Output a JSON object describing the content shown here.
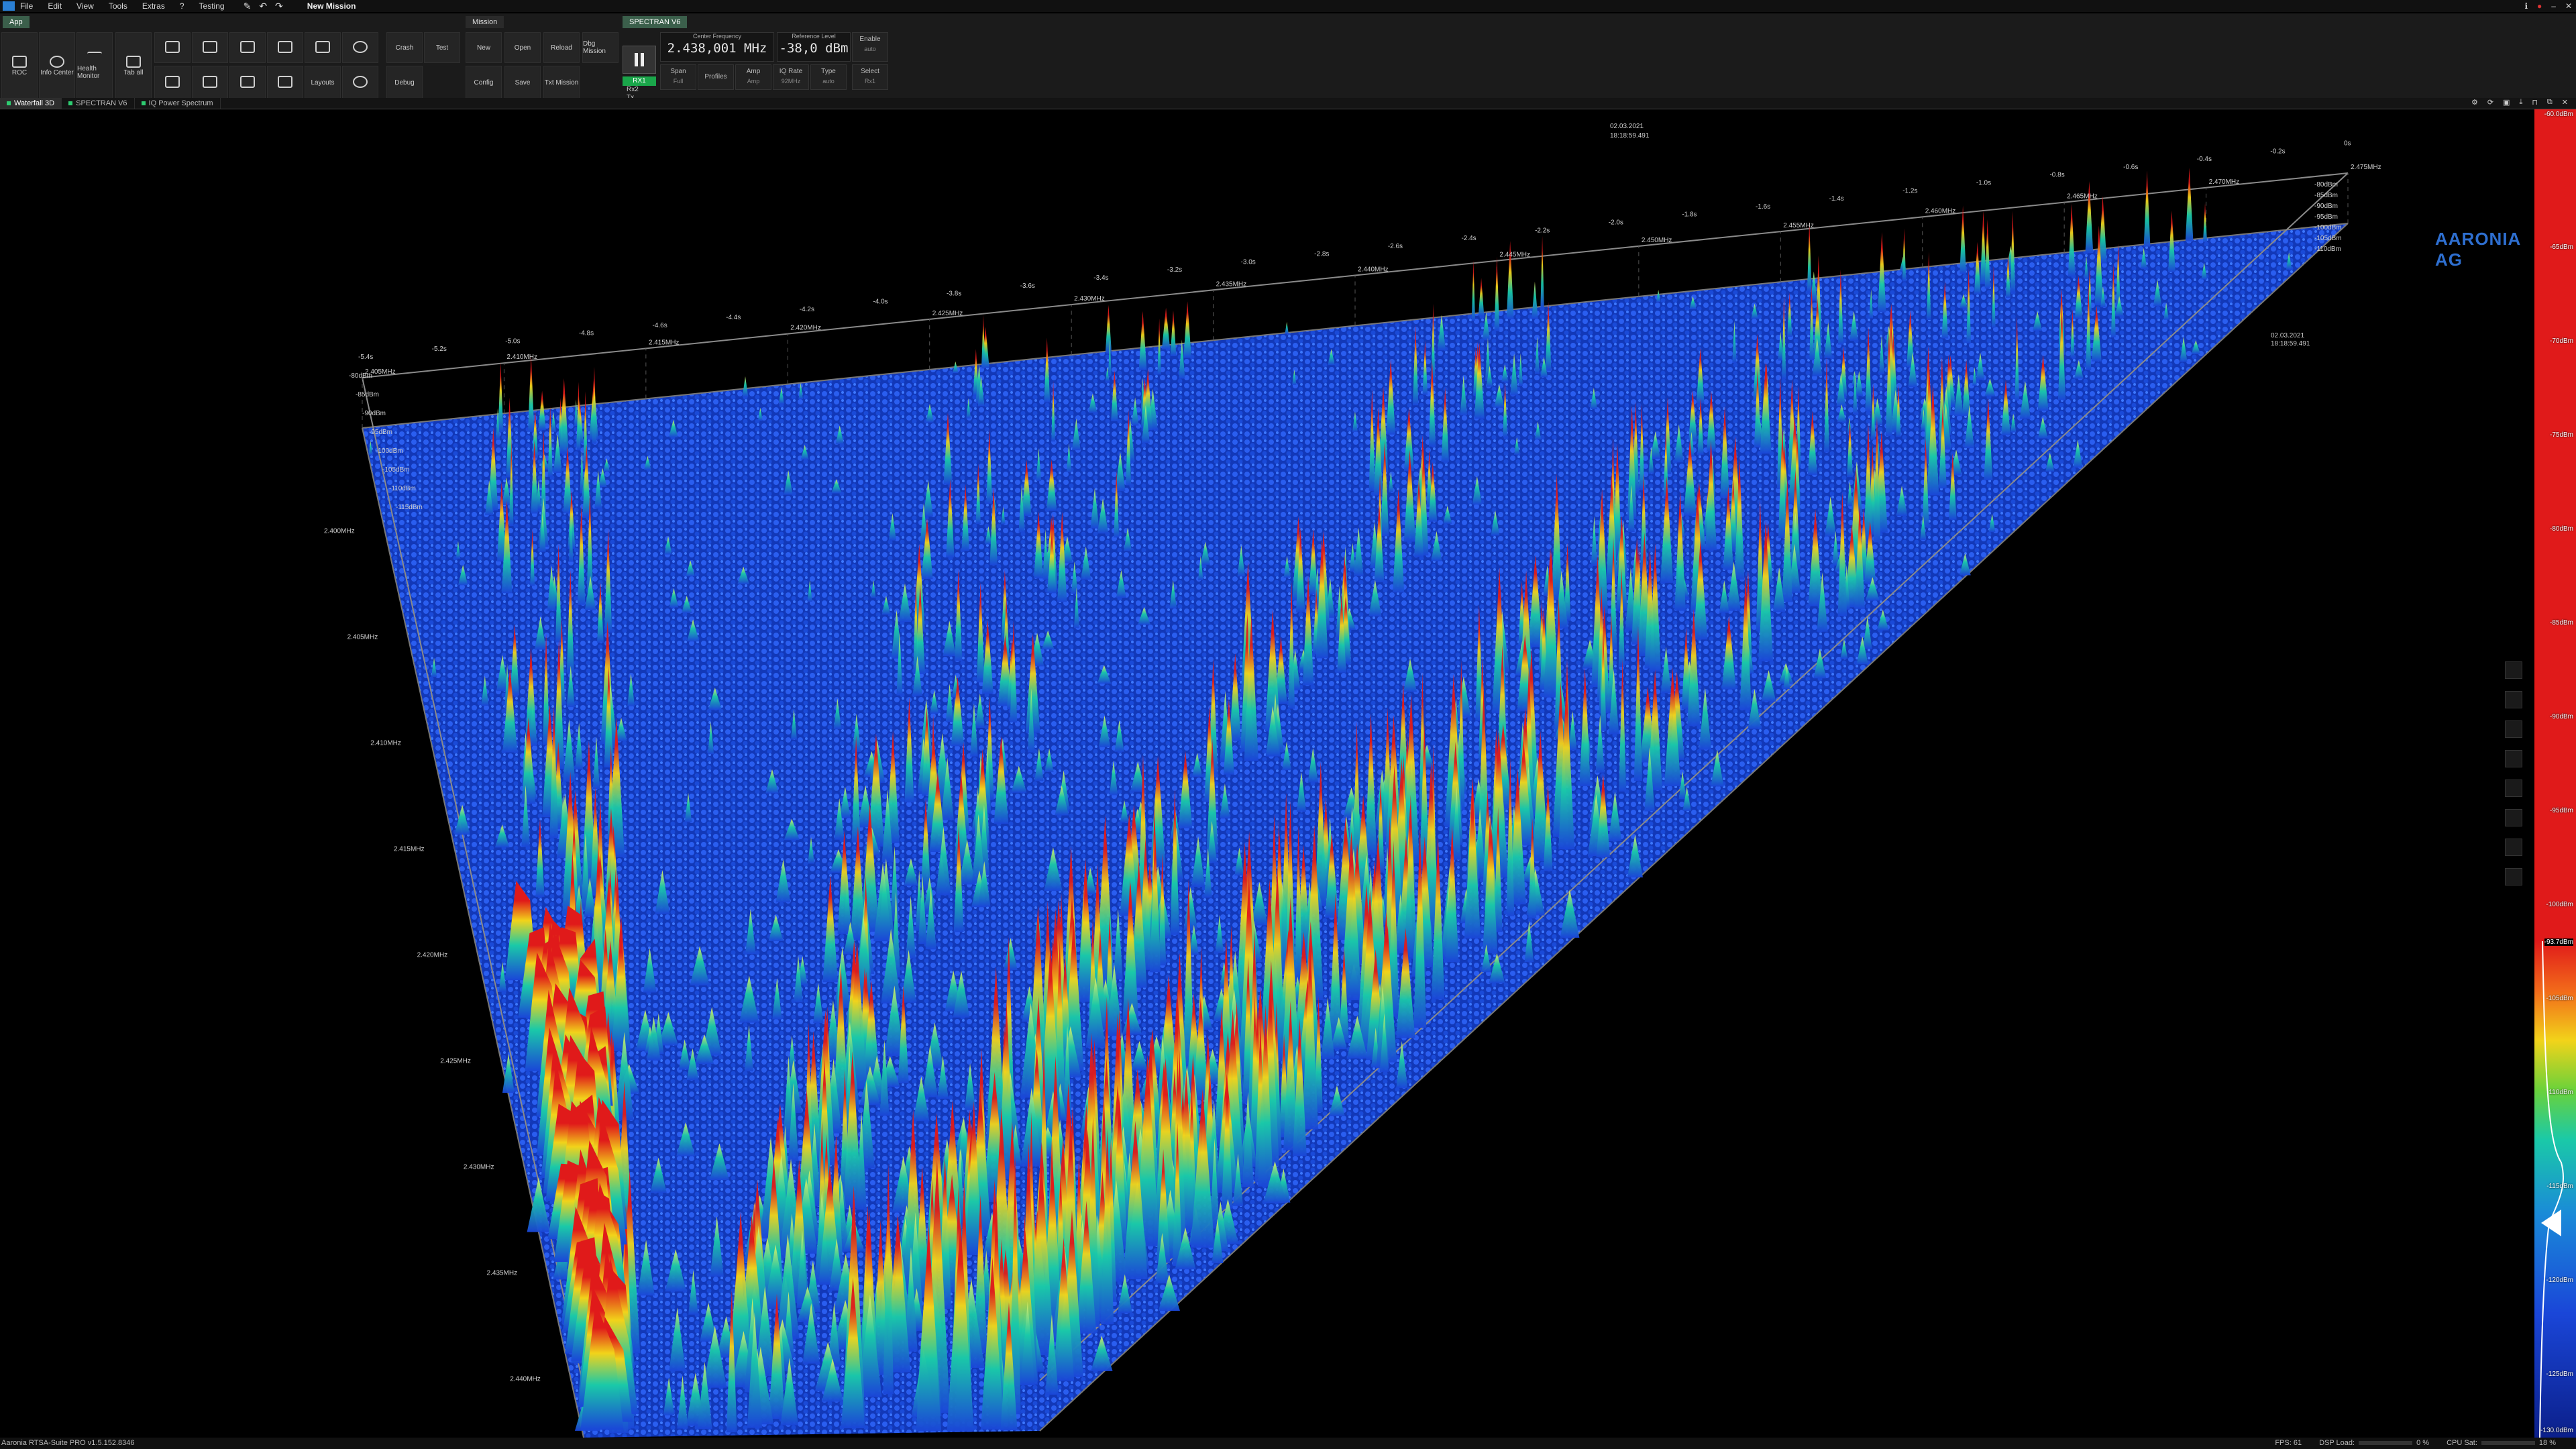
{
  "menu": {
    "items": [
      "File",
      "Edit",
      "View",
      "Tools",
      "Extras",
      "?",
      "Testing"
    ],
    "title": "New Mission"
  },
  "ribbon": {
    "app_tab": "App",
    "mission_tab": "Mission",
    "spectran_tab": "SPECTRAN V6",
    "app_buttons": [
      {
        "label": "ROC",
        "icon": "network-icon"
      },
      {
        "label": "Info Center",
        "icon": "info-icon"
      },
      {
        "label": "Health Monitor",
        "icon": "pulse-icon"
      },
      {
        "label": "Tab all",
        "icon": "single-pane-icon"
      }
    ],
    "layout_buttons_label": "Layouts",
    "crash_label": "Crash",
    "test_label": "Test",
    "debug_label": "Debug",
    "mission_buttons": {
      "new": "New",
      "open": "Open",
      "reload": "Reload",
      "dbg_mission": "Dbg Mission",
      "config": "Config",
      "save": "Save",
      "txt_mission": "Txt Mission"
    },
    "spectran": {
      "rx_badge": "RX1",
      "rx_label": "Rx2",
      "tx_label": "Tx",
      "center_freq_label": "Center Frequency",
      "center_freq_value": "2.438,001 MHz",
      "ref_level_label": "Reference Level",
      "ref_level_value": "-38,0 dBm",
      "enable_label": "Enable",
      "enable_value": "auto",
      "span_label": "Span",
      "span_value": "Full",
      "profiles_label": "Profiles",
      "amp_label": "Amp",
      "amp_value": "Amp",
      "iq_rate_label": "IQ Rate",
      "iq_rate_value": "92MHz",
      "type_label": "Type",
      "type_value": "auto",
      "select_label": "Select",
      "select_value": "Rx1"
    }
  },
  "doc_tabs": [
    "Waterfall 3D",
    "SPECTRAN V6",
    "IQ Power Spectrum"
  ],
  "plot": {
    "timestamp_date": "02.03.2021",
    "timestamp_time": "18:18:59.491",
    "side_time": "18:18:59.491",
    "side_date": "02.03.2021",
    "freq_ticks": [
      "2.405MHz",
      "2.410MHz",
      "2.415MHz",
      "2.420MHz",
      "2.425MHz",
      "2.430MHz",
      "2.435MHz",
      "2.440MHz",
      "2.445MHz",
      "2.450MHz",
      "2.455MHz",
      "2.460MHz",
      "2.465MHz",
      "2.470MHz",
      "2.475MHz"
    ],
    "left_freq_ticks": [
      "2.400MHz",
      "2.405MHz",
      "2.410MHz",
      "2.415MHz",
      "2.420MHz",
      "2.425MHz",
      "2.430MHz",
      "2.435MHz",
      "2.440MHz"
    ],
    "level_ticks_left": [
      "-80dBm",
      "-85dBm",
      "-90dBm",
      "-95dBm",
      "-100dBm",
      "-105dBm",
      "-110dBm",
      "-115dBm"
    ],
    "level_ticks_right": [
      "-80dBm",
      "-85dBm",
      "-90dBm",
      "-95dBm",
      "-100dBm",
      "-105dBm",
      "-110dBm"
    ],
    "time_ticks": [
      "-5.4s",
      "-5.2s",
      "-5.0s",
      "-4.8s",
      "-4.6s",
      "-4.4s",
      "-4.2s",
      "-4.0s",
      "-3.8s",
      "-3.6s",
      "-3.4s",
      "-3.2s",
      "-3.0s",
      "-2.8s",
      "-2.6s",
      "-2.4s",
      "-2.2s",
      "-2.0s",
      "-1.8s",
      "-1.6s",
      "-1.4s",
      "-1.2s",
      "-1.0s",
      "-0.8s",
      "-0.6s",
      "-0.4s",
      "-0.2s",
      "0s"
    ],
    "colors": {
      "peak": "#e01a1a",
      "mid": "#f2d31a",
      "low": "#1ac9a8",
      "floor": "#1a46d8"
    }
  },
  "colorbar": {
    "top_label": "-60.0dBm",
    "cursor_label": "-93.7dBm",
    "bottom_label": "-130.0dBm",
    "ticks": [
      "-65dBm",
      "-70dBm",
      "-75dBm",
      "-80dBm",
      "-85dBm",
      "-90dBm",
      "-95dBm",
      "-100dBm",
      "-105dBm",
      "-110dBm",
      "-115dBm",
      "-120dBm",
      "-125dBm"
    ]
  },
  "logo": {
    "text": "AARONIA AG"
  },
  "status": {
    "version": "Aaronia RTSA-Suite PRO v1.5.152.8346",
    "fps_label": "FPS:",
    "fps_value": "61",
    "dsp_label": "DSP Load:",
    "dsp_value": "0 %",
    "cpu_label": "CPU Sat:",
    "cpu_value": "18 %"
  }
}
